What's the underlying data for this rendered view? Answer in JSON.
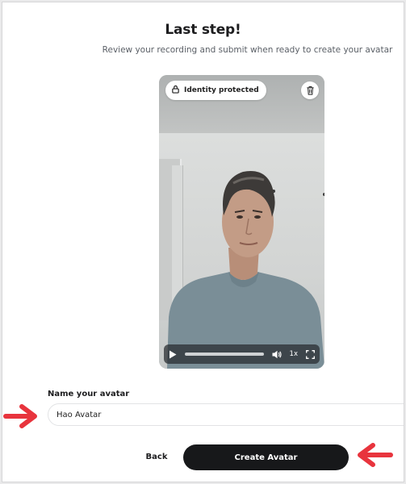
{
  "header": {
    "title": "Last step!",
    "subtitle": "Review your recording and submit when ready to create your avatar"
  },
  "video": {
    "badge_label": "Identity protected",
    "playback_rate": "1x",
    "progress": 0.0,
    "icons": {
      "badge": "lock-icon",
      "delete": "trash-icon",
      "play": "play-icon",
      "volume": "volume-icon",
      "fullscreen": "fullscreen-icon"
    }
  },
  "form": {
    "name_label": "Name your avatar",
    "name_value": "Hao Avatar"
  },
  "actions": {
    "back_label": "Back",
    "create_label": "Create Avatar"
  },
  "colors": {
    "primary_button": "#17181a",
    "annotation_arrow": "#e8343d"
  }
}
